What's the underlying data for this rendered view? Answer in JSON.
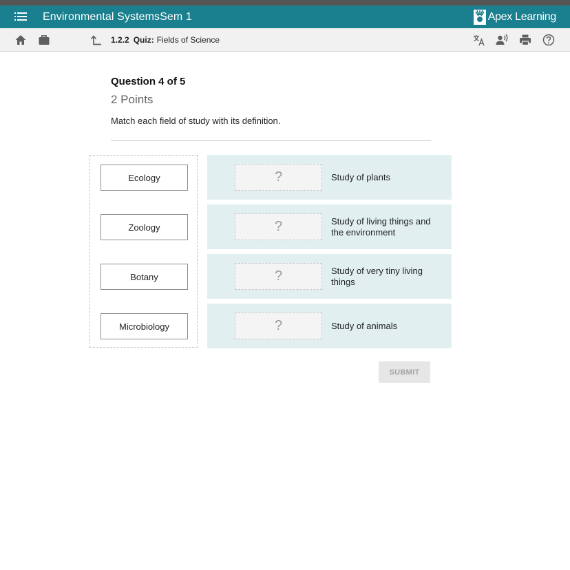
{
  "header": {
    "course_title": "Environmental SystemsSem 1",
    "brand_name": "Apex Learning",
    "brand_color": "#1a7f8e"
  },
  "toolbar": {
    "breadcrumb_number": "1.2.2",
    "breadcrumb_kind": "Quiz:",
    "breadcrumb_title": "Fields of Science",
    "icons": [
      "home-icon",
      "briefcase-icon",
      "up-arrow-icon",
      "translate-icon",
      "read-aloud-icon",
      "print-icon",
      "help-icon"
    ]
  },
  "question": {
    "title": "Question 4 of 5",
    "points": "2 Points",
    "prompt": "Match each field of study with its definition."
  },
  "terms": [
    "Ecology",
    "Zoology",
    "Botany",
    "Microbiology"
  ],
  "definitions": [
    {
      "placeholder": "?",
      "text": "Study of plants"
    },
    {
      "placeholder": "?",
      "text": "Study of living things and the environment"
    },
    {
      "placeholder": "?",
      "text": "Study of very tiny living things"
    },
    {
      "placeholder": "?",
      "text": "Study of animals"
    }
  ],
  "submit_label": "SUBMIT"
}
